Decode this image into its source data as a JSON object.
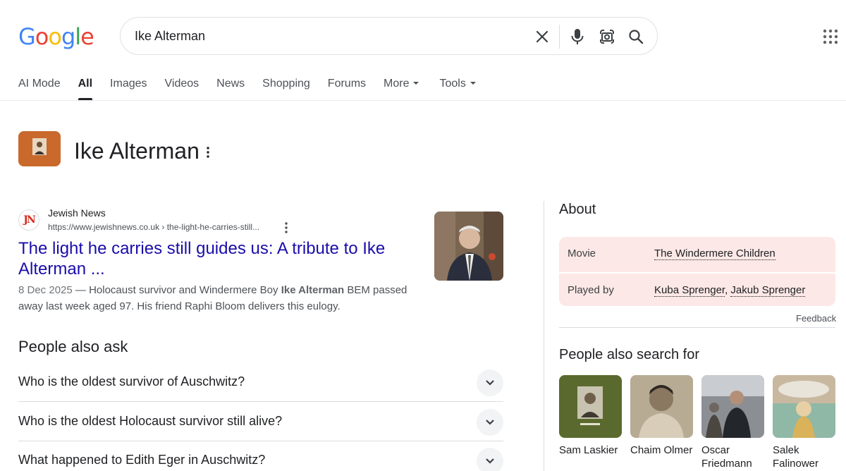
{
  "header": {
    "logo_letters": [
      {
        "ch": "G",
        "color": "#4285F4"
      },
      {
        "ch": "o",
        "color": "#EA4335"
      },
      {
        "ch": "o",
        "color": "#FBBC05"
      },
      {
        "ch": "g",
        "color": "#4285F4"
      },
      {
        "ch": "l",
        "color": "#34A853"
      },
      {
        "ch": "e",
        "color": "#EA4335"
      }
    ],
    "search_value": "Ike Alterman"
  },
  "tabs": [
    {
      "label": "AI Mode",
      "active": false
    },
    {
      "label": "All",
      "active": true
    },
    {
      "label": "Images",
      "active": false
    },
    {
      "label": "Videos",
      "active": false
    },
    {
      "label": "News",
      "active": false
    },
    {
      "label": "Shopping",
      "active": false
    },
    {
      "label": "Forums",
      "active": false
    },
    {
      "label": "More",
      "active": false,
      "dropdown": true
    },
    {
      "label": "Tools",
      "active": false,
      "dropdown": true
    }
  ],
  "entity": {
    "title": "Ike Alterman"
  },
  "result": {
    "favicon_text": "JN",
    "site_name": "Jewish News",
    "url": "https://www.jewishnews.co.uk › the-light-he-carries-still...",
    "title": "The light he carries still guides us: A tribute to Ike Alterman ...",
    "snippet_date": "8 Dec 2025",
    "snippet_pre": " — Holocaust survivor and Windermere Boy ",
    "snippet_bold": "Ike Alterman",
    "snippet_post": " BEM passed away last week aged 97. His friend Raphi Bloom delivers this eulogy."
  },
  "paa": {
    "title": "People also ask",
    "questions": [
      "Who is the oldest survivor of Auschwitz?",
      "Who is the oldest Holocaust survivor still alive?",
      "What happened to Edith Eger in Auschwitz?"
    ]
  },
  "about": {
    "title": "About",
    "movie_label": "Movie",
    "movie_value": "The Windermere Children",
    "played_by_label": "Played by",
    "actor_1": "Kuba Sprenger",
    "separator": ", ",
    "actor_2": "Jakub Sprenger",
    "feedback": "Feedback"
  },
  "people_also_search": {
    "title": "People also search for",
    "items": [
      {
        "name": "Sam Laskier"
      },
      {
        "name": "Chaim Olmer"
      },
      {
        "name": "Oscar Friedmann"
      },
      {
        "name": "Salek Falinower"
      }
    ]
  }
}
